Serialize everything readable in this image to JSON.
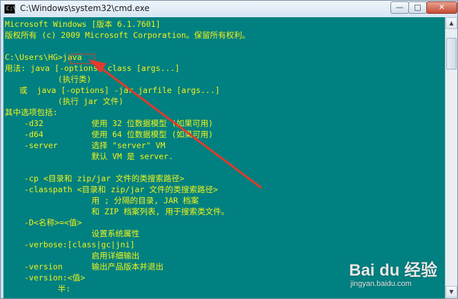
{
  "window": {
    "title": "C:\\Windows\\system32\\cmd.exe",
    "icon_text": "C:\\",
    "controls": {
      "minimize": "—",
      "maximize": "□",
      "close": "✕"
    }
  },
  "console": {
    "lines": [
      "Microsoft Windows [版本 6.1.7601]",
      "版权所有 (c) 2009 Microsoft Corporation。保留所有权利。",
      "",
      "C:\\Users\\HG>java",
      "用法: java [-options] class [args...]",
      "           (执行类)",
      "   或  java [-options] -jar jarfile [args...]",
      "           (执行 jar 文件)",
      "其中选项包括:",
      "    -d32          使用 32 位数据模型 (如果可用)",
      "    -d64          使用 64 位数据模型 (如果可用)",
      "    -server       选择 \"server\" VM",
      "                  默认 VM 是 server.",
      "",
      "    -cp <目录和 zip/jar 文件的类搜索路径>",
      "    -classpath <目录和 zip/jar 文件的类搜索路径>",
      "                  用 ; 分隔的目录, JAR 档案",
      "                  和 ZIP 档案列表, 用于搜索类文件。",
      "    -D<名称>=<值>",
      "                  设置系统属性",
      "    -verbose:[class|gc|jni]",
      "                  启用详细输出",
      "    -version      输出产品版本并退出",
      "    -version:<值>",
      "           半:"
    ],
    "highlight_text": "java",
    "colors": {
      "background": "#008080",
      "text": "#f1f21a",
      "highlight": "#e23a2c"
    }
  },
  "watermark": {
    "logo": "Bai du 经验",
    "url": "jingyan.baidu.com"
  }
}
